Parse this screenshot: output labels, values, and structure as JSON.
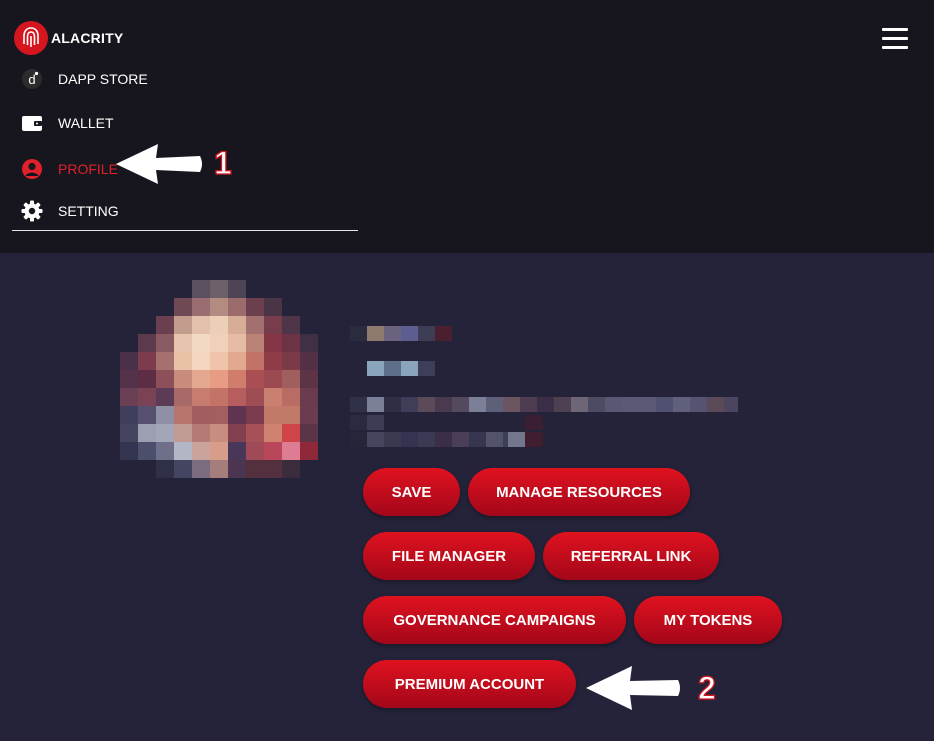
{
  "brand": {
    "name": "ALACRITY",
    "logo_icon": "fingerprint-logo-icon",
    "color": "#d5161f"
  },
  "menu": {
    "toggle_icon": "hamburger-menu-icon",
    "items": [
      {
        "label": "DAPP STORE",
        "icon": "dapp-store-icon",
        "active": false
      },
      {
        "label": "WALLET",
        "icon": "wallet-icon",
        "active": false
      },
      {
        "label": "PROFILE",
        "icon": "user-icon",
        "active": true
      },
      {
        "label": "SETTING",
        "icon": "gear-icon",
        "active": false
      }
    ]
  },
  "annotations": [
    {
      "number": "1",
      "target": "PROFILE"
    },
    {
      "number": "2",
      "target": "PREMIUM ACCOUNT"
    }
  ],
  "profile": {
    "avatar": "pixelated-avatar-image",
    "details_redacted": true
  },
  "actions": {
    "save": "SAVE",
    "manage_resources": "MANAGE RESOURCES",
    "file_manager": "FILE MANAGER",
    "referral_link": "REFERRAL LINK",
    "governance_campaigns": "GOVERNANCE CAMPAIGNS",
    "my_tokens": "MY TOKENS",
    "premium_account": "PREMIUM ACCOUNT"
  },
  "colors": {
    "nav_bg": "#17161f",
    "page_bg": "#24233a",
    "accent": "#e0212b",
    "button_top": "#e0121f",
    "button_bottom": "#a3071a"
  }
}
